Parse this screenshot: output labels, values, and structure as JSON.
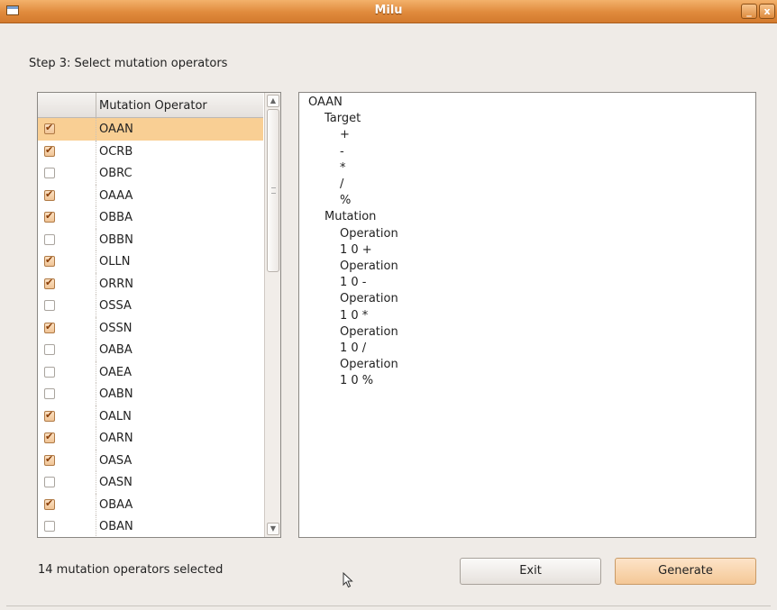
{
  "window": {
    "title": "Milu",
    "minimize_label": "_",
    "close_label": "x"
  },
  "step_label": "Step 3: Select mutation operators",
  "operator_table": {
    "column_header": "Mutation Operator",
    "rows": [
      {
        "name": "OAAN",
        "checked": true,
        "selected": true
      },
      {
        "name": "OCRB",
        "checked": true
      },
      {
        "name": "OBRC",
        "checked": false
      },
      {
        "name": "OAAA",
        "checked": true
      },
      {
        "name": "OBBA",
        "checked": true
      },
      {
        "name": "OBBN",
        "checked": false
      },
      {
        "name": "OLLN",
        "checked": true
      },
      {
        "name": "ORRN",
        "checked": true
      },
      {
        "name": "OSSA",
        "checked": false
      },
      {
        "name": "OSSN",
        "checked": true
      },
      {
        "name": "OABA",
        "checked": false
      },
      {
        "name": "OAEA",
        "checked": false
      },
      {
        "name": "OABN",
        "checked": false
      },
      {
        "name": "OALN",
        "checked": true
      },
      {
        "name": "OARN",
        "checked": true
      },
      {
        "name": "OASA",
        "checked": true
      },
      {
        "name": "OASN",
        "checked": false
      },
      {
        "name": "OBAA",
        "checked": true
      },
      {
        "name": "OBAN",
        "checked": false
      }
    ]
  },
  "detail_tree": [
    {
      "text": "OAAN",
      "level": 0
    },
    {
      "text": "Target",
      "level": 1
    },
    {
      "text": "+",
      "level": 2
    },
    {
      "text": "-",
      "level": 2
    },
    {
      "text": "*",
      "level": 2
    },
    {
      "text": "/",
      "level": 2
    },
    {
      "text": "%",
      "level": 2
    },
    {
      "text": "Mutation",
      "level": 1
    },
    {
      "text": "Operation",
      "level": 2
    },
    {
      "text": "1 0 +",
      "level": 2
    },
    {
      "text": "Operation",
      "level": 2
    },
    {
      "text": "1 0 -",
      "level": 2
    },
    {
      "text": "Operation",
      "level": 2
    },
    {
      "text": "1 0 *",
      "level": 2
    },
    {
      "text": "Operation",
      "level": 2
    },
    {
      "text": "1 0 /",
      "level": 2
    },
    {
      "text": "Operation",
      "level": 2
    },
    {
      "text": "1 0 %",
      "level": 2
    }
  ],
  "status_text": "14 mutation operators selected",
  "buttons": {
    "exit": "Exit",
    "generate": "Generate"
  }
}
